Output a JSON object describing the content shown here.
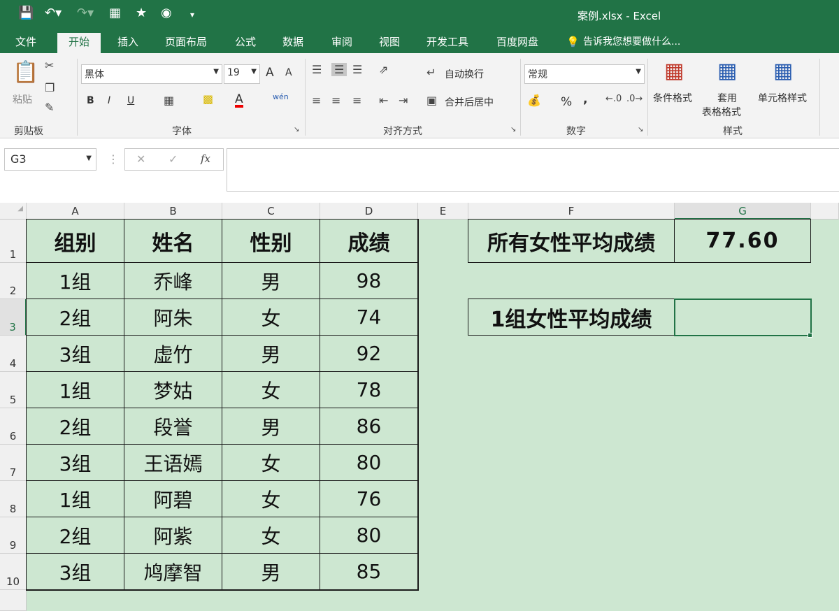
{
  "window": {
    "title": "案例.xlsx - Excel"
  },
  "quick_access": {
    "save_icon": "save-icon",
    "undo_icon": "undo-icon",
    "redo_icon": "redo-icon"
  },
  "tabs": [
    {
      "label": "文件"
    },
    {
      "label": "开始",
      "active": true
    },
    {
      "label": "插入"
    },
    {
      "label": "页面布局"
    },
    {
      "label": "公式"
    },
    {
      "label": "数据"
    },
    {
      "label": "审阅"
    },
    {
      "label": "视图"
    },
    {
      "label": "开发工具"
    },
    {
      "label": "百度网盘"
    }
  ],
  "tell_me": "告诉我您想要做什么...",
  "ribbon": {
    "clipboard": {
      "paste": "粘贴",
      "label": "剪贴板"
    },
    "font": {
      "name": "黑体",
      "size": "19",
      "label": "字体",
      "bold": "B",
      "italic": "I",
      "underline": "U",
      "grow": "A",
      "shrink": "A",
      "font_color": "A",
      "phonetic": "wén"
    },
    "alignment": {
      "wrap": "自动换行",
      "merge": "合并后居中",
      "label": "对齐方式"
    },
    "number": {
      "format": "常规",
      "percent": "%",
      "comma": ",",
      "label": "数字"
    },
    "styles": {
      "conditional": "条件格式",
      "table_format_1": "套用",
      "table_format_2": "表格格式",
      "cell_style": "单元格样式",
      "label": "样式"
    }
  },
  "formula_bar": {
    "name_box": "G3",
    "fx": "fx",
    "value": ""
  },
  "columns": [
    "A",
    "B",
    "C",
    "D",
    "E",
    "F",
    "G"
  ],
  "rows": [
    "1",
    "2",
    "3",
    "4",
    "5",
    "6",
    "7",
    "8",
    "9",
    "10"
  ],
  "table": {
    "headers": [
      "组别",
      "姓名",
      "性别",
      "成绩"
    ],
    "rows": [
      [
        "1组",
        "乔峰",
        "男",
        "98"
      ],
      [
        "2组",
        "阿朱",
        "女",
        "74"
      ],
      [
        "3组",
        "虚竹",
        "男",
        "92"
      ],
      [
        "1组",
        "梦姑",
        "女",
        "78"
      ],
      [
        "2组",
        "段誉",
        "男",
        "86"
      ],
      [
        "3组",
        "王语嫣",
        "女",
        "80"
      ],
      [
        "1组",
        "阿碧",
        "女",
        "76"
      ],
      [
        "2组",
        "阿紫",
        "女",
        "80"
      ],
      [
        "3组",
        "鸠摩智",
        "男",
        "85"
      ]
    ]
  },
  "summary": {
    "label1": "所有女性平均成绩",
    "value1": "77.60",
    "label2": "1组女性平均成绩",
    "value2": ""
  }
}
